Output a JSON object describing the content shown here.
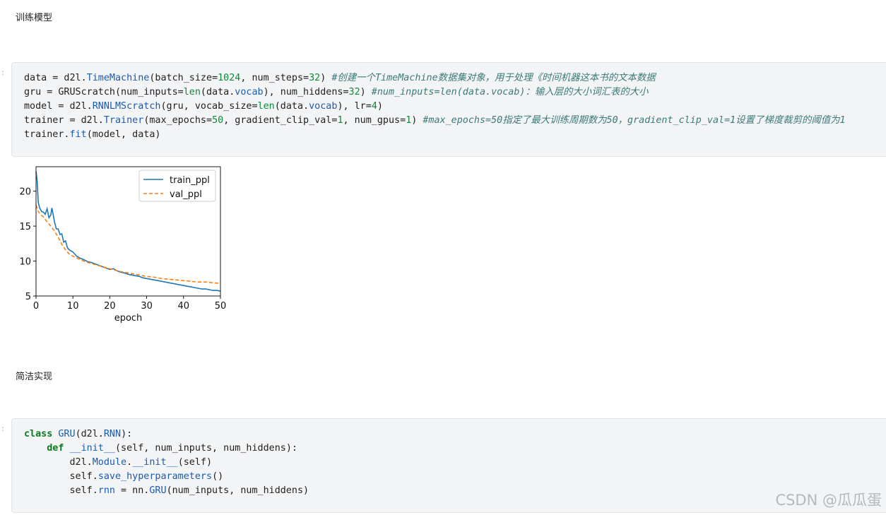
{
  "headings": {
    "train": "训练模型",
    "concise": "简洁实现"
  },
  "cell1": {
    "lines": [
      "data = d2l.TimeMachine(batch_size=1024, num_steps=32) #创建一个TimeMachine数据集对象，用于处理《时间机器这本书的文本数据",
      "gru = GRUScratch(num_inputs=len(data.vocab), num_hiddens=32) #num_inputs=len(data.vocab)：输入层的大小词汇表的大小",
      "model = d2l.RNNLMScratch(gru, vocab_size=len(data.vocab), lr=4)",
      "trainer = d2l.Trainer(max_epochs=50, gradient_clip_val=1, num_gpus=1) #max_epochs=50指定了最大训练周期数为50，gradient_clip_val=1设置了梯度裁剪的阈值为1",
      "trainer.fit(model, data)"
    ]
  },
  "cell2": {
    "lines": [
      "class GRU(d2l.RNN):",
      "    def __init__(self, num_inputs, num_hiddens):",
      "        d2l.Module.__init__(self)",
      "        self.save_hyperparameters()",
      "        self.rnn = nn.GRU(num_inputs, num_hiddens)"
    ]
  },
  "gutter_marker": ":",
  "watermark": "CSDN @瓜瓜蛋",
  "chart_data": {
    "type": "line",
    "xlabel": "epoch",
    "ylabel": "",
    "xlim": [
      0,
      50
    ],
    "ylim": [
      5,
      23.5
    ],
    "xticks": [
      0,
      10,
      20,
      30,
      40,
      50
    ],
    "yticks": [
      5,
      10,
      15,
      20
    ],
    "legend_position": "top-right",
    "grid": false,
    "series": [
      {
        "name": "train_ppl",
        "color": "#1f77b4",
        "style": "solid",
        "x": [
          0,
          0.3,
          0.6,
          1,
          1.5,
          2,
          2.5,
          3,
          3.5,
          4,
          4.3,
          4.6,
          5,
          5.5,
          6,
          6.5,
          7,
          7.5,
          8,
          8.5,
          9,
          10,
          11,
          12,
          13,
          14,
          15,
          16,
          17,
          18,
          19,
          20,
          21,
          22,
          23,
          24,
          25,
          26,
          27,
          28,
          29,
          30,
          31,
          32,
          33,
          34,
          35,
          36,
          37,
          38,
          39,
          40,
          41,
          42,
          43,
          44,
          45,
          46,
          47,
          48,
          49,
          50
        ],
        "y": [
          22.8,
          21.5,
          18.4,
          17.6,
          17.1,
          17.0,
          16.7,
          17.5,
          16.2,
          16.6,
          17.6,
          16.8,
          15.6,
          14.6,
          14.6,
          13.8,
          13.9,
          12.7,
          12.9,
          11.9,
          11.6,
          11.3,
          10.7,
          10.4,
          10.2,
          9.9,
          9.8,
          9.6,
          9.4,
          9.2,
          9.0,
          8.8,
          8.9,
          8.6,
          8.4,
          8.3,
          8.1,
          8.0,
          7.9,
          7.8,
          7.6,
          7.5,
          7.4,
          7.3,
          7.2,
          7.1,
          7.0,
          6.9,
          6.8,
          6.7,
          6.6,
          6.5,
          6.4,
          6.3,
          6.2,
          6.1,
          6.0,
          6.0,
          5.9,
          5.8,
          5.8,
          5.7
        ]
      },
      {
        "name": "val_ppl",
        "color": "#ff7f0e",
        "style": "dashed",
        "x": [
          0,
          0.5,
          1,
          2,
          3,
          4,
          5,
          6,
          7,
          8,
          9,
          10,
          12,
          14,
          16,
          18,
          20,
          22,
          24,
          26,
          28,
          30,
          32,
          34,
          36,
          38,
          40,
          42,
          44,
          46,
          48,
          50
        ],
        "y": [
          18.0,
          17.2,
          16.8,
          16.3,
          15.6,
          15.0,
          14.3,
          13.4,
          12.4,
          11.6,
          11.0,
          10.7,
          10.2,
          9.8,
          9.5,
          9.2,
          8.9,
          8.6,
          8.4,
          8.2,
          8.0,
          7.8,
          7.7,
          7.5,
          7.4,
          7.3,
          7.2,
          7.1,
          7.0,
          7.0,
          6.9,
          6.8
        ]
      }
    ]
  }
}
